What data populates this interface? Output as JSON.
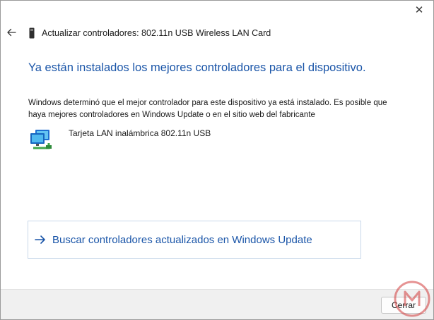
{
  "window": {
    "title": "Actualizar controladores: 802.11n USB Wireless LAN Card",
    "close_glyph": "✕",
    "close_icon": "close-icon",
    "back_icon": "back-arrow-icon"
  },
  "main": {
    "heading": "Ya están instalados los mejores controladores para el dispositivo.",
    "description": "Windows determinó que el mejor controlador para este dispositivo ya está instalado. Es posible que haya mejores controladores en Windows Update o en el sitio web del fabricante",
    "device": {
      "name": "Tarjeta LAN inalámbrica 802.11n USB",
      "icon": "network-adapter-icon"
    },
    "update_link": {
      "label": "Buscar controladores actualizados en Windows Update",
      "icon": "right-arrow-icon"
    }
  },
  "footer": {
    "cancel_label": "Cerrar"
  },
  "colors": {
    "accent": "#1a55a8",
    "link_border": "#c8d8ea",
    "footer_bg": "#f0f0f0",
    "watermark": "#d23c3c"
  }
}
